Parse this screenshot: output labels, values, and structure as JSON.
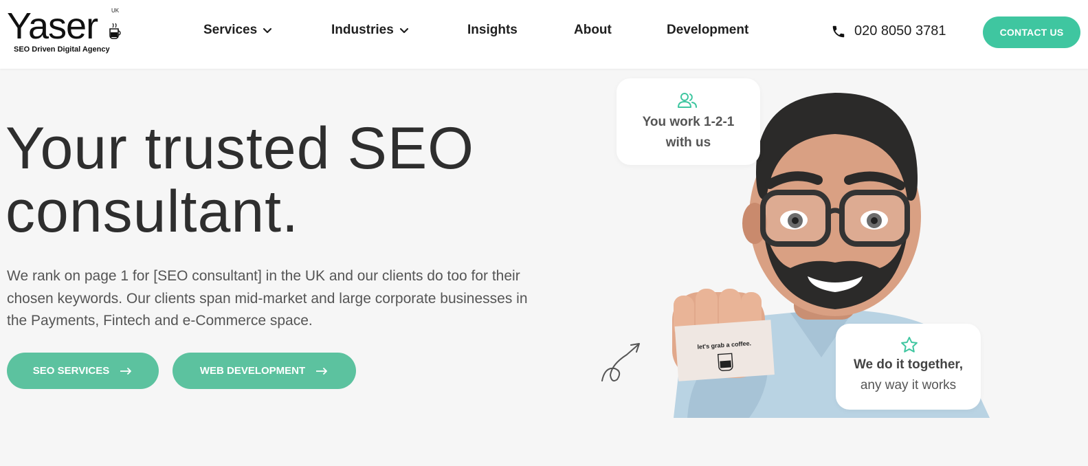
{
  "brand": {
    "name": "Yaser",
    "superscript": "UK",
    "tagline": "SEO Driven Digital Agency"
  },
  "nav": {
    "items": [
      {
        "label": "Services",
        "has_dropdown": true
      },
      {
        "label": "Industries",
        "has_dropdown": true
      },
      {
        "label": "Insights",
        "has_dropdown": false
      },
      {
        "label": "About",
        "has_dropdown": false
      },
      {
        "label": "Development",
        "has_dropdown": false
      }
    ],
    "phone": "020 8050 3781",
    "contact_label": "CONTACT US"
  },
  "hero": {
    "title_line1": "Your trusted SEO",
    "title_line2": "consultant.",
    "description": "We rank on page 1 for [SEO consultant] in the UK and our clients do too for their chosen keywords. Our clients span mid-market and large corporate businesses in the Payments, Fintech and e-Commerce space.",
    "buttons": {
      "seo_services": "SEO SERVICES",
      "web_development": "WEB DEVELOPMENT"
    }
  },
  "illustration": {
    "card_one": {
      "icon": "users-icon",
      "text_line1": "You work 1-2-1",
      "text_line2": "with us"
    },
    "card_two": {
      "icon": "star-icon",
      "text_bold": "We do it together,",
      "text_regular": "any way it works"
    },
    "business_card_text": "let's grab a coffee."
  },
  "colors": {
    "accent": "#3fc6a0",
    "button": "#5cc29f",
    "background": "#f6f6f6",
    "text_dark": "#2e2e2e"
  }
}
